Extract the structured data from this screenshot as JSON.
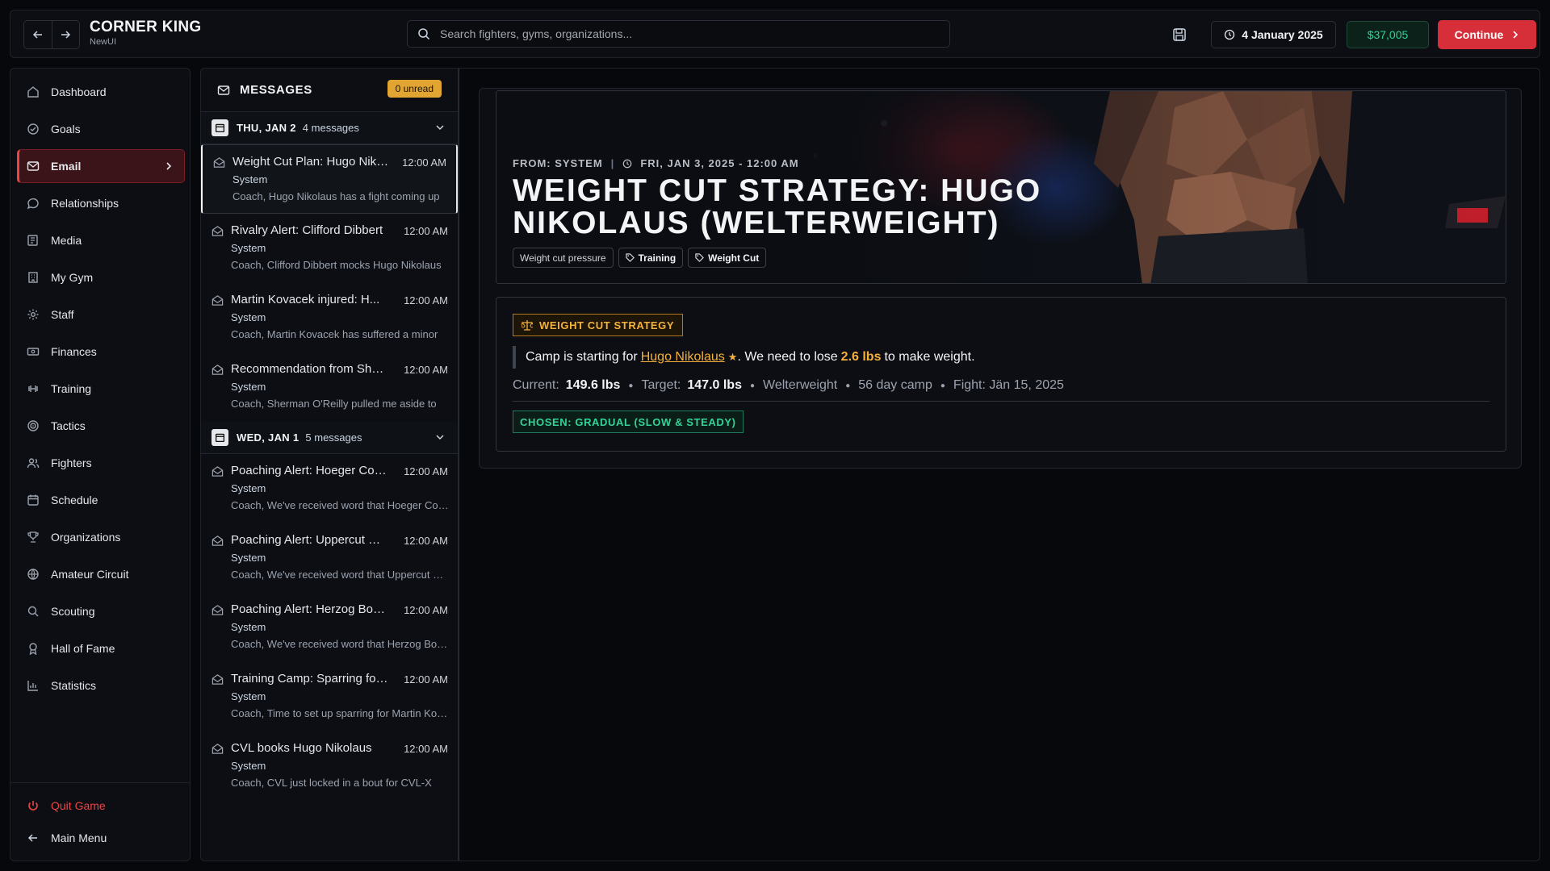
{
  "app": {
    "title": "CORNER KING",
    "subtitle": "NewUI"
  },
  "header": {
    "search_placeholder": "Search fighters, gyms, organizations...",
    "date": "4 January 2025",
    "money": "$37,005",
    "continue_label": "Continue"
  },
  "sidebar": {
    "items": [
      {
        "label": "Dashboard",
        "icon": "home-icon"
      },
      {
        "label": "Goals",
        "icon": "check-circle-icon"
      },
      {
        "label": "Email",
        "icon": "mail-icon",
        "active": true
      },
      {
        "label": "Relationships",
        "icon": "chat-bubble-icon"
      },
      {
        "label": "Media",
        "icon": "newspaper-icon"
      },
      {
        "label": "My Gym",
        "icon": "building-icon"
      },
      {
        "label": "Staff",
        "icon": "gear-icon"
      },
      {
        "label": "Finances",
        "icon": "banknote-icon"
      },
      {
        "label": "Training",
        "icon": "dumbbell-icon"
      },
      {
        "label": "Tactics",
        "icon": "target-icon"
      },
      {
        "label": "Fighters",
        "icon": "users-icon"
      },
      {
        "label": "Schedule",
        "icon": "calendar-icon"
      },
      {
        "label": "Organizations",
        "icon": "trophy-icon"
      },
      {
        "label": "Amateur Circuit",
        "icon": "globe-icon"
      },
      {
        "label": "Scouting",
        "icon": "search-icon"
      },
      {
        "label": "Hall of Fame",
        "icon": "award-icon"
      },
      {
        "label": "Statistics",
        "icon": "bar-chart-icon"
      }
    ],
    "quit_label": "Quit Game",
    "main_menu_label": "Main Menu"
  },
  "messages": {
    "title": "MESSAGES",
    "unread_badge": "0 unread",
    "groups": [
      {
        "date": "THU, JAN 2",
        "count": "4 messages",
        "items": [
          {
            "subject": "Weight Cut Plan: Hugo Nikolaus",
            "time": "12:00 AM",
            "from": "System",
            "preview": "Coach, Hugo Nikolaus has a fight coming up",
            "selected": true
          },
          {
            "subject": "Rivalry Alert: Clifford Dibbert",
            "time": "12:00 AM",
            "from": "System",
            "preview": "Coach, Clifford Dibbert mocks Hugo Nikolaus"
          },
          {
            "subject": "Martin Kovacek injured: H...",
            "time": "12:00 AM",
            "from": "System",
            "preview": "Coach, Martin Kovacek has suffered a minor"
          },
          {
            "subject": "Recommendation from Sherman",
            "time": "12:00 AM",
            "from": "System",
            "preview": "Coach, Sherman O'Reilly pulled me aside to"
          }
        ]
      },
      {
        "date": "WED, JAN 1",
        "count": "5 messages",
        "items": [
          {
            "subject": "Poaching Alert: Hoeger Combat",
            "time": "12:00 AM",
            "from": "System",
            "preview": "Coach, We've received word that Hoeger Combat"
          },
          {
            "subject": "Poaching Alert: Uppercut Gym",
            "time": "12:00 AM",
            "from": "System",
            "preview": "Coach, We've received word that Uppercut Gym"
          },
          {
            "subject": "Poaching Alert: Herzog Boxing",
            "time": "12:00 AM",
            "from": "System",
            "preview": "Coach, We've received word that Herzog Boxing"
          },
          {
            "subject": "Training Camp: Sparring for Martin",
            "time": "12:00 AM",
            "from": "System",
            "preview": "Coach, Time to set up sparring for Martin Kovacek"
          },
          {
            "subject": "CVL books Hugo Nikolaus",
            "time": "12:00 AM",
            "from": "System",
            "preview": "Coach, CVL just locked in a bout for CVL-X"
          }
        ]
      }
    ]
  },
  "email": {
    "from_label": "FROM: SYSTEM",
    "sent": "FRI, JAN 3, 2025 - 12:00 AM",
    "title": "WEIGHT CUT STRATEGY: HUGO NIKOLAUS (WELTERWEIGHT)",
    "tags": [
      "Weight cut pressure",
      "Training",
      "Weight Cut"
    ],
    "strategy_label": "WEIGHT CUT STRATEGY",
    "quote_pre": "Camp is starting for",
    "fighter": "Hugo Nikolaus",
    "quote_mid": ". We need to lose",
    "amount": "2.6 lbs",
    "quote_post": "to make weight.",
    "current_label": "Current:",
    "current": "149.6 lbs",
    "target_label": "Target:",
    "target": "147.0 lbs",
    "division": "Welterweight",
    "camp": "56 day camp",
    "fight": "Fight: Jän 15, 2025",
    "chosen": "CHOSEN: GRADUAL (SLOW & STEADY)"
  },
  "colors": {
    "accent": "#d62f3a",
    "gold": "#f5b13b",
    "green": "#34d399"
  }
}
